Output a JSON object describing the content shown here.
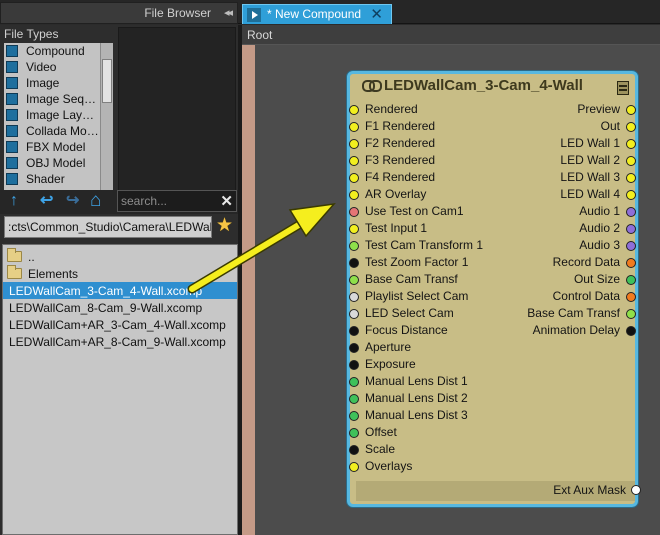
{
  "topbar": {
    "file_browser_label": "File Browser",
    "collapse_glyph": "◂◂",
    "tab_label": "* New Compound",
    "tab_close_glyph": "✕"
  },
  "file_types": {
    "header": "File Types",
    "items": [
      "Compound",
      "Video",
      "Image",
      "Image Seq…",
      "Image Lay…",
      "Collada Mo…",
      "FBX Model",
      "OBJ Model",
      "Shader"
    ]
  },
  "nav": {
    "up_icon": "↑",
    "back_icon": "↩",
    "forward_icon": "↪",
    "home_icon": "⌂"
  },
  "search": {
    "placeholder": "search...",
    "value": "",
    "clear_glyph": "✕"
  },
  "path": {
    "value": ":cts\\Common_Studio\\Camera\\LEDWallCam",
    "favorite_icon": "★"
  },
  "files": {
    "folders": [
      "..",
      "Elements"
    ],
    "items": [
      "LEDWallCam_3-Cam_4-Wall.xcomp",
      "LEDWallCam_8-Cam_9-Wall.xcomp",
      "LEDWallCam+AR_3-Cam_4-Wall.xcomp",
      "LEDWallCam+AR_8-Cam_9-Wall.xcomp"
    ],
    "selected_index": 0
  },
  "breadcrumb": "Root",
  "node": {
    "title": "LEDWallCam_3-Cam_4-Wall",
    "inputs": [
      {
        "label": "Rendered",
        "color": "#f2ef1f"
      },
      {
        "label": "F1 Rendered",
        "color": "#f2ef1f"
      },
      {
        "label": "F2 Rendered",
        "color": "#f2ef1f"
      },
      {
        "label": "F3 Rendered",
        "color": "#f2ef1f"
      },
      {
        "label": "F4 Rendered",
        "color": "#f2ef1f"
      },
      {
        "label": "AR Overlay",
        "color": "#f2ef1f"
      },
      {
        "label": "Use Test on Cam1",
        "color": "#e57575"
      },
      {
        "label": "Test Input 1",
        "color": "#f2ef1f"
      },
      {
        "label": "Test Cam Transform 1",
        "color": "#8fe04a"
      },
      {
        "label": "Test Zoom Factor 1",
        "color": "#111111"
      },
      {
        "label": "Base Cam Transf",
        "color": "#8fe04a"
      },
      {
        "label": "Playlist Select Cam",
        "color": "#d9d9d9"
      },
      {
        "label": "LED Select Cam",
        "color": "#d9d9d9"
      },
      {
        "label": "Focus Distance",
        "color": "#111111"
      },
      {
        "label": "Aperture",
        "color": "#111111"
      },
      {
        "label": "Exposure",
        "color": "#111111"
      },
      {
        "label": "Manual Lens Dist 1",
        "color": "#3fc15a"
      },
      {
        "label": "Manual Lens Dist 2",
        "color": "#3fc15a"
      },
      {
        "label": "Manual Lens Dist 3",
        "color": "#3fc15a"
      },
      {
        "label": "Offset",
        "color": "#3fc15a"
      },
      {
        "label": "Scale",
        "color": "#111111"
      },
      {
        "label": "Overlays",
        "color": "#f2ef1f"
      }
    ],
    "outputs": [
      {
        "label": "Preview",
        "color": "#f2ef1f"
      },
      {
        "label": "Out",
        "color": "#f2ef1f"
      },
      {
        "label": "LED Wall 1",
        "color": "#f2ef1f"
      },
      {
        "label": "LED Wall 2",
        "color": "#f2ef1f"
      },
      {
        "label": "LED Wall 3",
        "color": "#f2ef1f"
      },
      {
        "label": "LED Wall 4",
        "color": "#f2ef1f"
      },
      {
        "label": "Audio 1",
        "color": "#8e6fd8"
      },
      {
        "label": "Audio 2",
        "color": "#8e6fd8"
      },
      {
        "label": "Audio 3",
        "color": "#8e6fd8"
      },
      {
        "label": "Record Data",
        "color": "#f07b1f"
      },
      {
        "label": "Out Size",
        "color": "#3fc15a"
      },
      {
        "label": "Control Data",
        "color": "#f07b1f"
      },
      {
        "label": "Base Cam Transf",
        "color": "#8fe04a"
      },
      {
        "label": "Animation Delay",
        "color": "#111111"
      }
    ],
    "aux": {
      "label": "Ext Aux Mask",
      "color": "#ffffff"
    }
  },
  "colors": {
    "accent": "#2f9fd8",
    "node_body": "#c8bd86",
    "node_border": "#57b8e0",
    "annotation_arrow": "#f5ee1e"
  }
}
